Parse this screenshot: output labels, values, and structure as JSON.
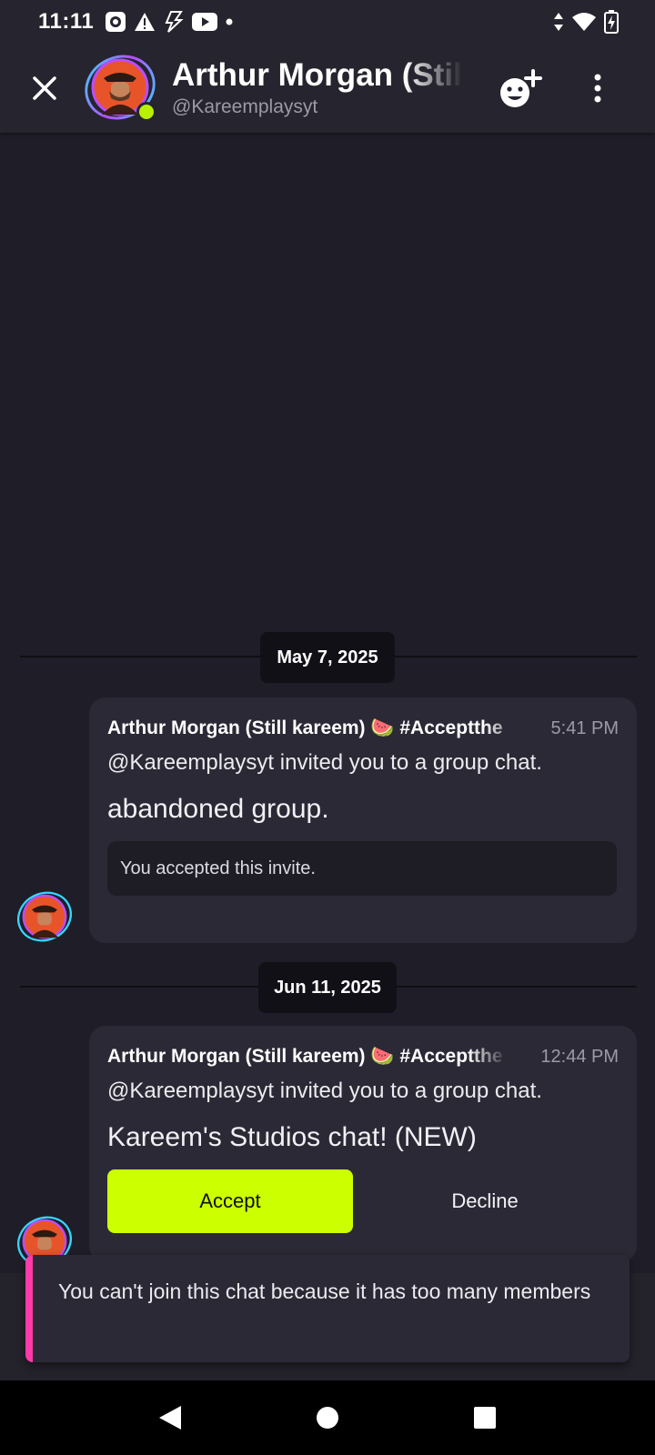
{
  "status_bar": {
    "time": "11:11"
  },
  "header": {
    "title": "Arthur Morgan (Still kareem) 🍉 #Accepttheinvite",
    "subtitle": "@Kareemplaysyt"
  },
  "messages": [
    {
      "date": "May 7, 2025",
      "author": "Arthur Morgan (Still kareem) 🍉 #Acceptthe",
      "time": "5:41 PM",
      "line": "@Kareemplaysyt invited you to a group chat.",
      "group_name": "abandoned group.",
      "status": "You accepted this invite."
    },
    {
      "date": "Jun 11, 2025",
      "author": "Arthur Morgan (Still kareem) 🍉 #Acceptthe",
      "time": "12:44 PM",
      "line": "@Kareemplaysyt invited you to a group chat.",
      "group_name": "Kareem's Studios chat! (NEW)",
      "accept_label": "Accept",
      "decline_label": "Decline"
    }
  ],
  "toast": {
    "message": "You can't join this chat because it has too many members"
  },
  "colors": {
    "accent": "#ccff00",
    "toast_accent": "#ff3aa8",
    "online": "#b8f000"
  }
}
